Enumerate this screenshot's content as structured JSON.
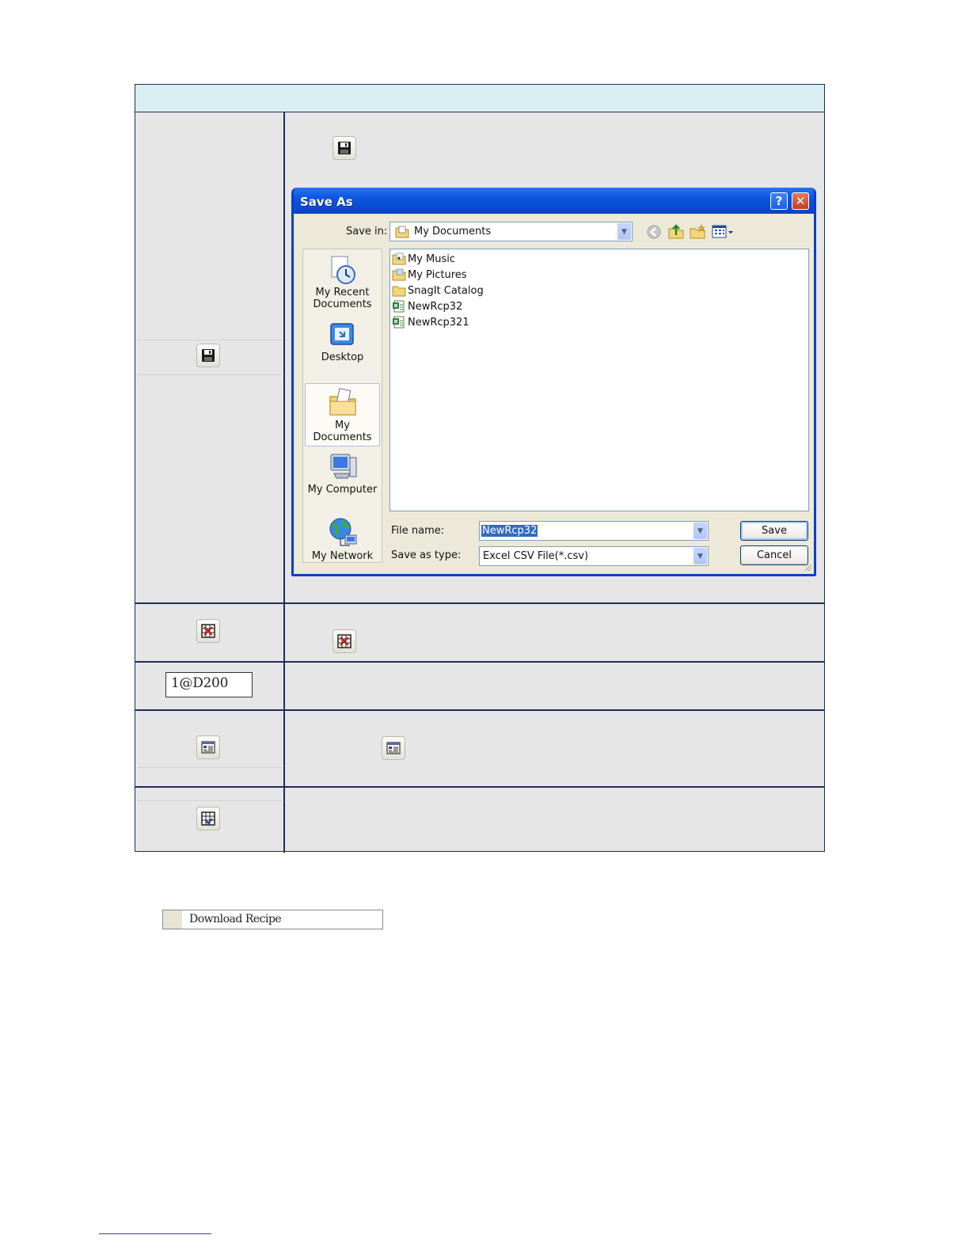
{
  "table": {
    "header_text": "",
    "address_value": "1@D200"
  },
  "icons": {
    "save": "floppy-disk-icon",
    "clear_table": "grid-x-icon",
    "list_view": "list-window-icon",
    "grid_check": "grid-check-icon"
  },
  "dialog": {
    "title": "Save As",
    "help_glyph": "?",
    "close_glyph": "✕",
    "save_in_label": "Save in:",
    "save_in_value": "My Documents",
    "places": [
      "My Recent\nDocuments",
      "Desktop",
      "My Documents",
      "My Computer",
      "My Network"
    ],
    "files": [
      {
        "name": "My Music",
        "type": "music-folder"
      },
      {
        "name": "My Pictures",
        "type": "picture-folder"
      },
      {
        "name": "SnagIt Catalog",
        "type": "folder"
      },
      {
        "name": "NewRcp32",
        "type": "excel-file"
      },
      {
        "name": "NewRcp321",
        "type": "excel-file"
      }
    ],
    "file_name_label": "File name:",
    "file_name_value": "NewRcp32",
    "save_type_label": "Save as type:",
    "save_type_value": "Excel CSV File(*.csv)",
    "save_button": "Save",
    "cancel_button": "Cancel"
  },
  "download_recipe": "Download Recipe",
  "colors": {
    "table_border": "#1c2c5c",
    "table_header_bg": "#d8eef0",
    "cell_bg": "#e6e6e6",
    "xp_blue": "#0a4bd2",
    "dialog_face": "#ece9d8"
  }
}
